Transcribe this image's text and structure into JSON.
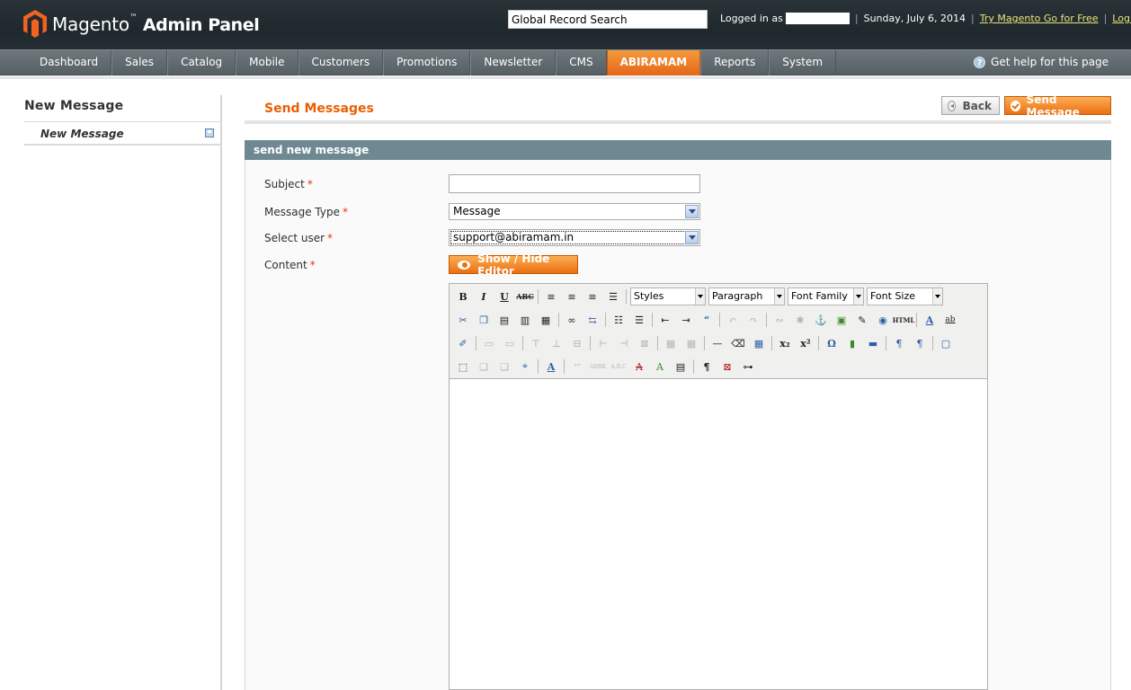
{
  "header": {
    "logo_brand": "Magento",
    "logo_tm": "™",
    "logo_suffix": "Admin Panel",
    "search_value": "Global Record Search",
    "logged_in_label": "Logged in as",
    "date": "Sunday, July 6, 2014",
    "try_link": "Try Magento Go for Free",
    "logout_link": "Log Out"
  },
  "nav": {
    "items": [
      "Dashboard",
      "Sales",
      "Catalog",
      "Mobile",
      "Customers",
      "Promotions",
      "Newsletter",
      "CMS",
      "ABIRAMAM",
      "Reports",
      "System"
    ],
    "active": "ABIRAMAM",
    "help": "Get help for this page"
  },
  "sidebar": {
    "title": "New Message",
    "tab_label": "New Message"
  },
  "main": {
    "title": "Send Messages",
    "back_label": "Back",
    "send_label": "Send Message",
    "fieldset_title": "send new message",
    "fields": {
      "subject_label": "Subject",
      "subject_value": "",
      "type_label": "Message Type",
      "type_value": "Message",
      "user_label": "Select user",
      "user_value": "support@abiramam.in",
      "content_label": "Content",
      "required_mark": "*"
    },
    "toggle_editor": "Show / Hide Editor",
    "editor": {
      "styles": "Styles",
      "paragraph": "Paragraph",
      "font_family": "Font Family",
      "font_size": "Font Size"
    }
  },
  "colors": {
    "accent_orange": "#eb5e00",
    "header_bg": "#252e33",
    "fieldset_head": "#6f8992"
  }
}
